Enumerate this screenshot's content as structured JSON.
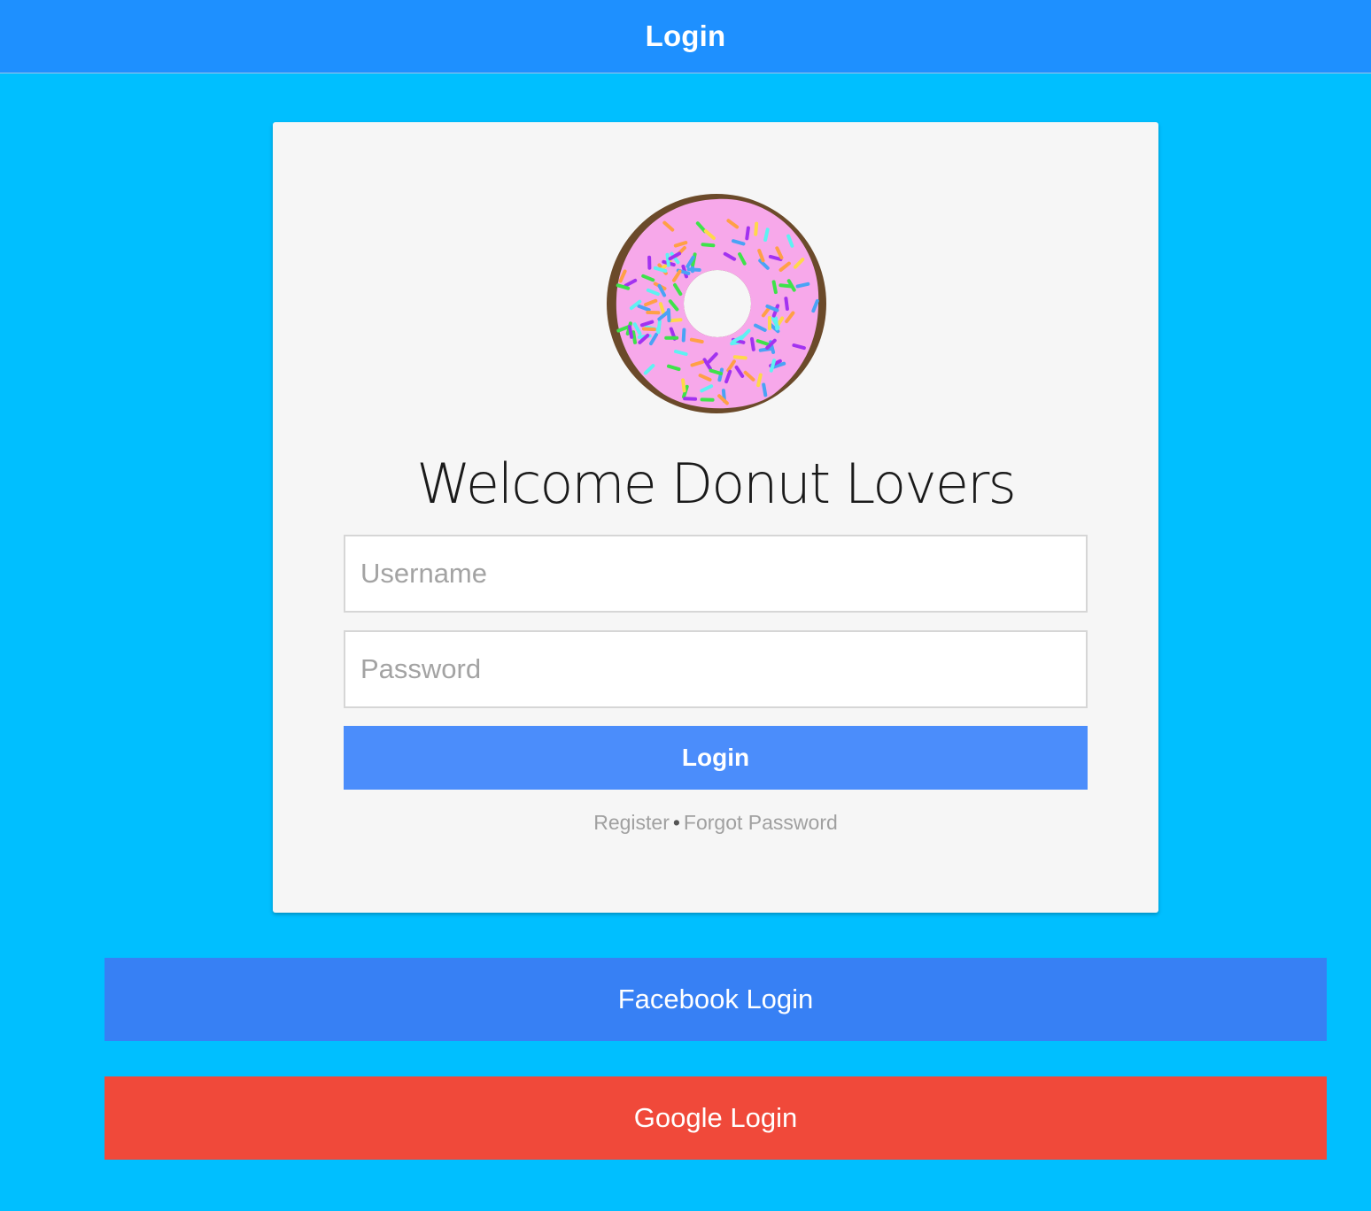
{
  "header": {
    "title": "Login"
  },
  "card": {
    "logo_icon": "donut-icon",
    "welcome_text": "Welcome Donut Lovers",
    "username_placeholder": "Username",
    "password_placeholder": "Password",
    "login_label": "Login",
    "register_label": "Register",
    "separator": "•",
    "forgot_label": "Forgot Password"
  },
  "social": {
    "facebook_label": "Facebook Login",
    "google_label": "Google Login"
  },
  "colors": {
    "page_background": "#00bfff",
    "header_background": "#1e90ff",
    "login_button": "#4b8dfb",
    "facebook_button": "#3780f4",
    "google_button": "#f0493a",
    "donut_frosting": "#f7a8ea",
    "donut_dough": "#6b4a2a"
  }
}
